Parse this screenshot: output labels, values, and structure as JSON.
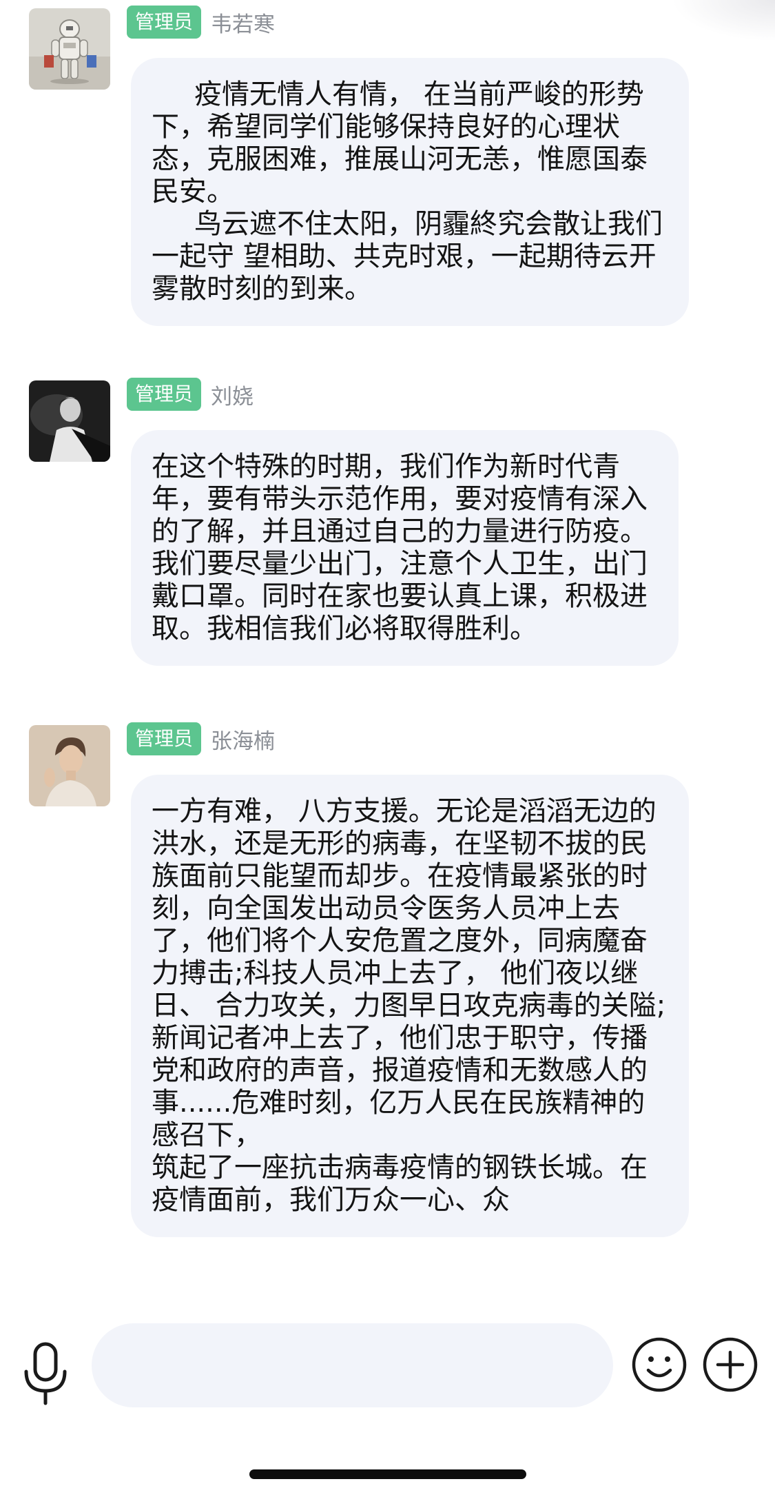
{
  "messages": [
    {
      "badge": "管理员",
      "name": "韦若寒",
      "avatar_icon": "astronaut-avatar",
      "paragraphs": [
        "疫情无情人有情， 在当前严峻的形势下，希望同学们能够保持良好的心理状态，克服困难，推展山河无恙，惟愿国泰民安。",
        "鸟云遮不住太阳，阴霾終究会散让我们一起守 望相助、共克时艰，一起期待云开雾散时刻的到来。"
      ]
    },
    {
      "badge": "管理员",
      "name": "刘娆",
      "avatar_icon": "person-dark-avatar",
      "paragraphs": [
        "在这个特殊的时期，我们作为新时代青年，要有带头示范作用，要对疫情有深入的了解，并且通过自己的力量进行防疫。我们要尽量少出门，注意个人卫生，出门戴口罩。同时在家也要认真上课，积极进取。我相信我们必将取得胜利。"
      ]
    },
    {
      "badge": "管理员",
      "name": "张海楠",
      "avatar_icon": "person-portrait-avatar",
      "paragraphs": [
        "一方有难， 八方支援。无论是滔滔无边的洪水，还是无形的病毒，在坚韧不拔的民族面前只能望而却步。在疫情最紧张的时刻，向全国发出动员令医务人员冲上去了，他们将个人安危置之度外，同病魔奋力搏击;科技人员冲上去了， 他们夜以继日、 合力攻关，力图早日攻克病毒的关隘;新闻记者冲上去了，他们忠于职守，传播党和政府的声音，报道疫情和无数感人的事......危难时刻，亿万人民在民族精神的感召下，",
        "筑起了一座抗击病毒疫情的钢铁长城。在疫情面前，我们万众一心、众"
      ]
    }
  ],
  "input_bar": {
    "mic_icon": "microphone-icon",
    "input_value": "",
    "emoji_icon": "smiley-icon",
    "plus_icon": "plus-icon"
  },
  "colors": {
    "badge": "#5cc58f",
    "bubble": "#f2f4fa",
    "name": "#8b8f96"
  }
}
